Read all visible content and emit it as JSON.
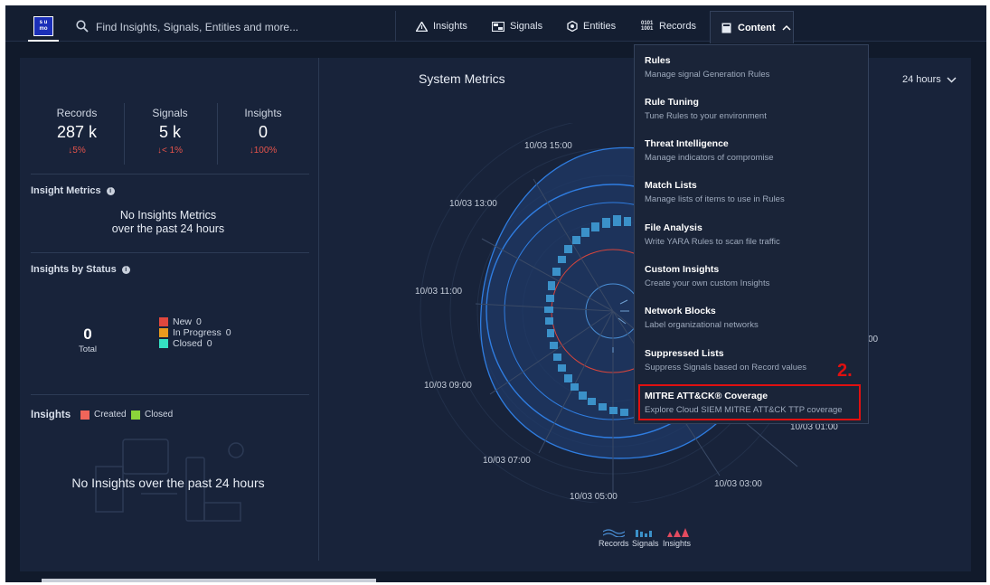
{
  "logo": {
    "line1": "s u",
    "line2": "mo"
  },
  "search": {
    "placeholder": "Find Insights, Signals, Entities and more..."
  },
  "nav": {
    "insights": "Insights",
    "signals": "Signals",
    "entities": "Entities",
    "records_icon": "0101 1001",
    "records": "Records",
    "content": "Content"
  },
  "stats": [
    {
      "label": "Records",
      "value": "287 k",
      "change": "↓5%"
    },
    {
      "label": "Signals",
      "value": "5 k",
      "change": "↓< 1%"
    },
    {
      "label": "Insights",
      "value": "0",
      "change": "↓100%"
    }
  ],
  "insight_metrics": {
    "title": "Insight Metrics",
    "empty_line1": "No Insights Metrics",
    "empty_line2": "over the past 24 hours"
  },
  "insights_by_status": {
    "title": "Insights by Status",
    "total_value": "0",
    "total_label": "Total",
    "legend": [
      {
        "label": "New",
        "count": "0",
        "color": "#e0473e"
      },
      {
        "label": "In Progress",
        "count": "0",
        "color": "#e89a1e"
      },
      {
        "label": "Closed",
        "count": "0",
        "color": "#35e0c2"
      }
    ]
  },
  "insights_chart": {
    "title": "Insights",
    "legend": [
      {
        "label": "Created",
        "color": "#f0655a"
      },
      {
        "label": "Closed",
        "color": "#8bd33a"
      }
    ],
    "empty": "No Insights over the past 24 hours"
  },
  "system_metrics": {
    "title": "System Metrics",
    "range": "24 hours",
    "time_labels": [
      "10/03 15:00",
      "10/03 13:00",
      "10/03 11:00",
      "10/03 09:00",
      "10/03 07:00",
      "10/03 05:00",
      "10/03 03:00",
      "10/03 01:00",
      "00"
    ],
    "legend": [
      "Records",
      "Signals",
      "Insights"
    ]
  },
  "content_menu": [
    {
      "title": "Rules",
      "desc": "Manage signal Generation Rules"
    },
    {
      "title": "Rule Tuning",
      "desc": "Tune Rules to your environment"
    },
    {
      "title": "Threat Intelligence",
      "desc": "Manage indicators of compromise"
    },
    {
      "title": "Match Lists",
      "desc": "Manage lists of items to use in Rules"
    },
    {
      "title": "File Analysis",
      "desc": "Write YARA Rules to scan file traffic"
    },
    {
      "title": "Custom Insights",
      "desc": "Create your own custom Insights"
    },
    {
      "title": "Network Blocks",
      "desc": "Label organizational networks"
    },
    {
      "title": "Suppressed Lists",
      "desc": "Suppress Signals based on Record values"
    },
    {
      "title": "MITRE ATT&CK® Coverage",
      "desc": "Explore Cloud SIEM MITRE ATT&CK TTP coverage"
    }
  ],
  "annotation": {
    "step": "2."
  },
  "colors": {
    "accent": "#2f7de1",
    "highlight": "#e01010"
  }
}
